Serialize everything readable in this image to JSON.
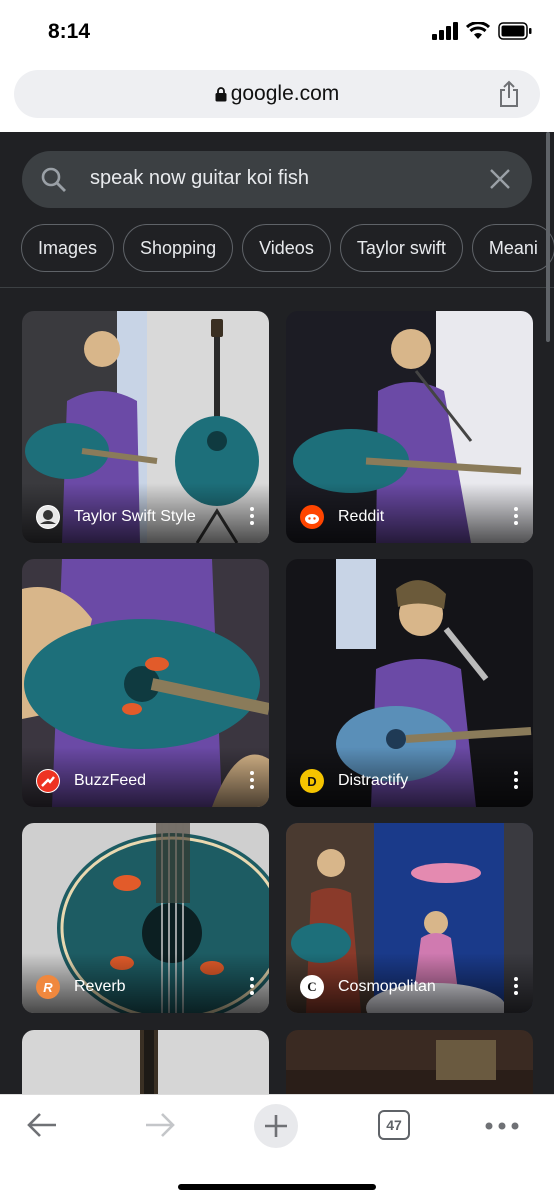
{
  "status": {
    "time": "8:14"
  },
  "browser": {
    "url": "google.com",
    "tab_count": "47"
  },
  "search": {
    "query": "speak now guitar koi fish"
  },
  "chips": [
    "Images",
    "Shopping",
    "Videos",
    "Taylor swift",
    "Meani"
  ],
  "results": [
    {
      "source": "Taylor Swift Style",
      "favicon": "globe-icon"
    },
    {
      "source": "Reddit",
      "favicon": "reddit-icon"
    },
    {
      "source": "BuzzFeed",
      "favicon": "buzzfeed-icon"
    },
    {
      "source": "Distractify",
      "favicon": "distractify-icon"
    },
    {
      "source": "Reverb",
      "favicon": "reverb-icon"
    },
    {
      "source": "Cosmopolitan",
      "favicon": "cosmopolitan-icon"
    }
  ],
  "favicon_letters": {
    "distractify": "D",
    "reverb": "R",
    "cosmopolitan": "C"
  },
  "colors": {
    "page_bg": "#202124",
    "chip_border": "#5f6368",
    "reddit": "#ff4500",
    "buzzfeed": "#ee3322",
    "reverb": "#f0883e",
    "guitar_teal": "#1d6f7a",
    "dress_purple": "#6b4aa6"
  }
}
